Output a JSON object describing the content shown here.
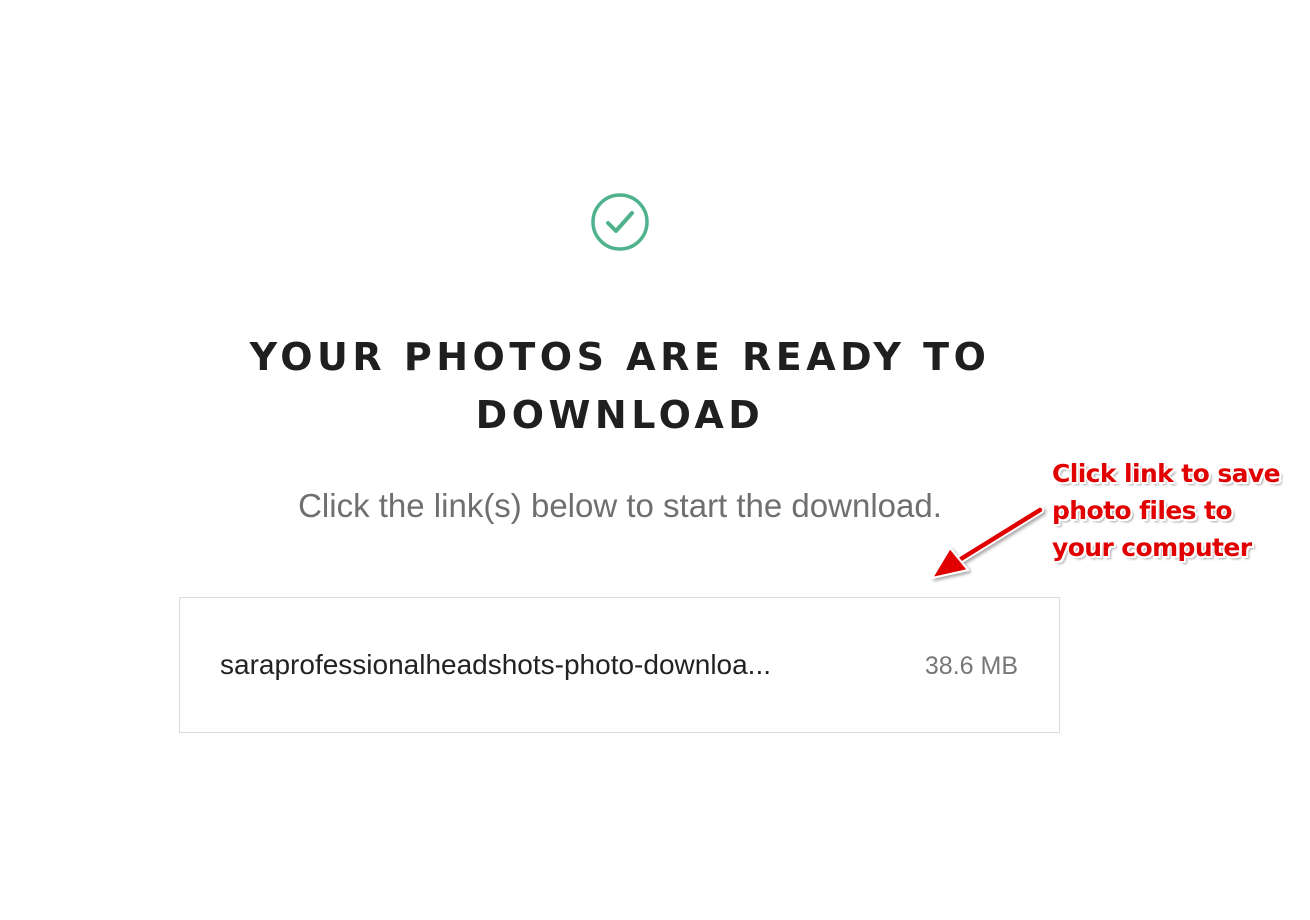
{
  "header": {
    "title_line1": "YOUR PHOTOS ARE READY TO",
    "title_line2": "DOWNLOAD",
    "subtitle": "Click the link(s) below to start the download.",
    "status_icon": "check-circle-icon"
  },
  "downloads": [
    {
      "file_name": "saraprofessionalheadshots-photo-downloa...",
      "file_size": "38.6 MB"
    }
  ],
  "annotation": {
    "lines": [
      "Click link to save",
      "photo files to",
      "your computer"
    ],
    "pointer_icon": "arrow-icon"
  },
  "colors": {
    "accent": "#4fb28c",
    "annotation": "#e00000",
    "title": "#1f1f1f",
    "subtitle": "#6f6f6f",
    "box_border": "#dcdcdc"
  }
}
